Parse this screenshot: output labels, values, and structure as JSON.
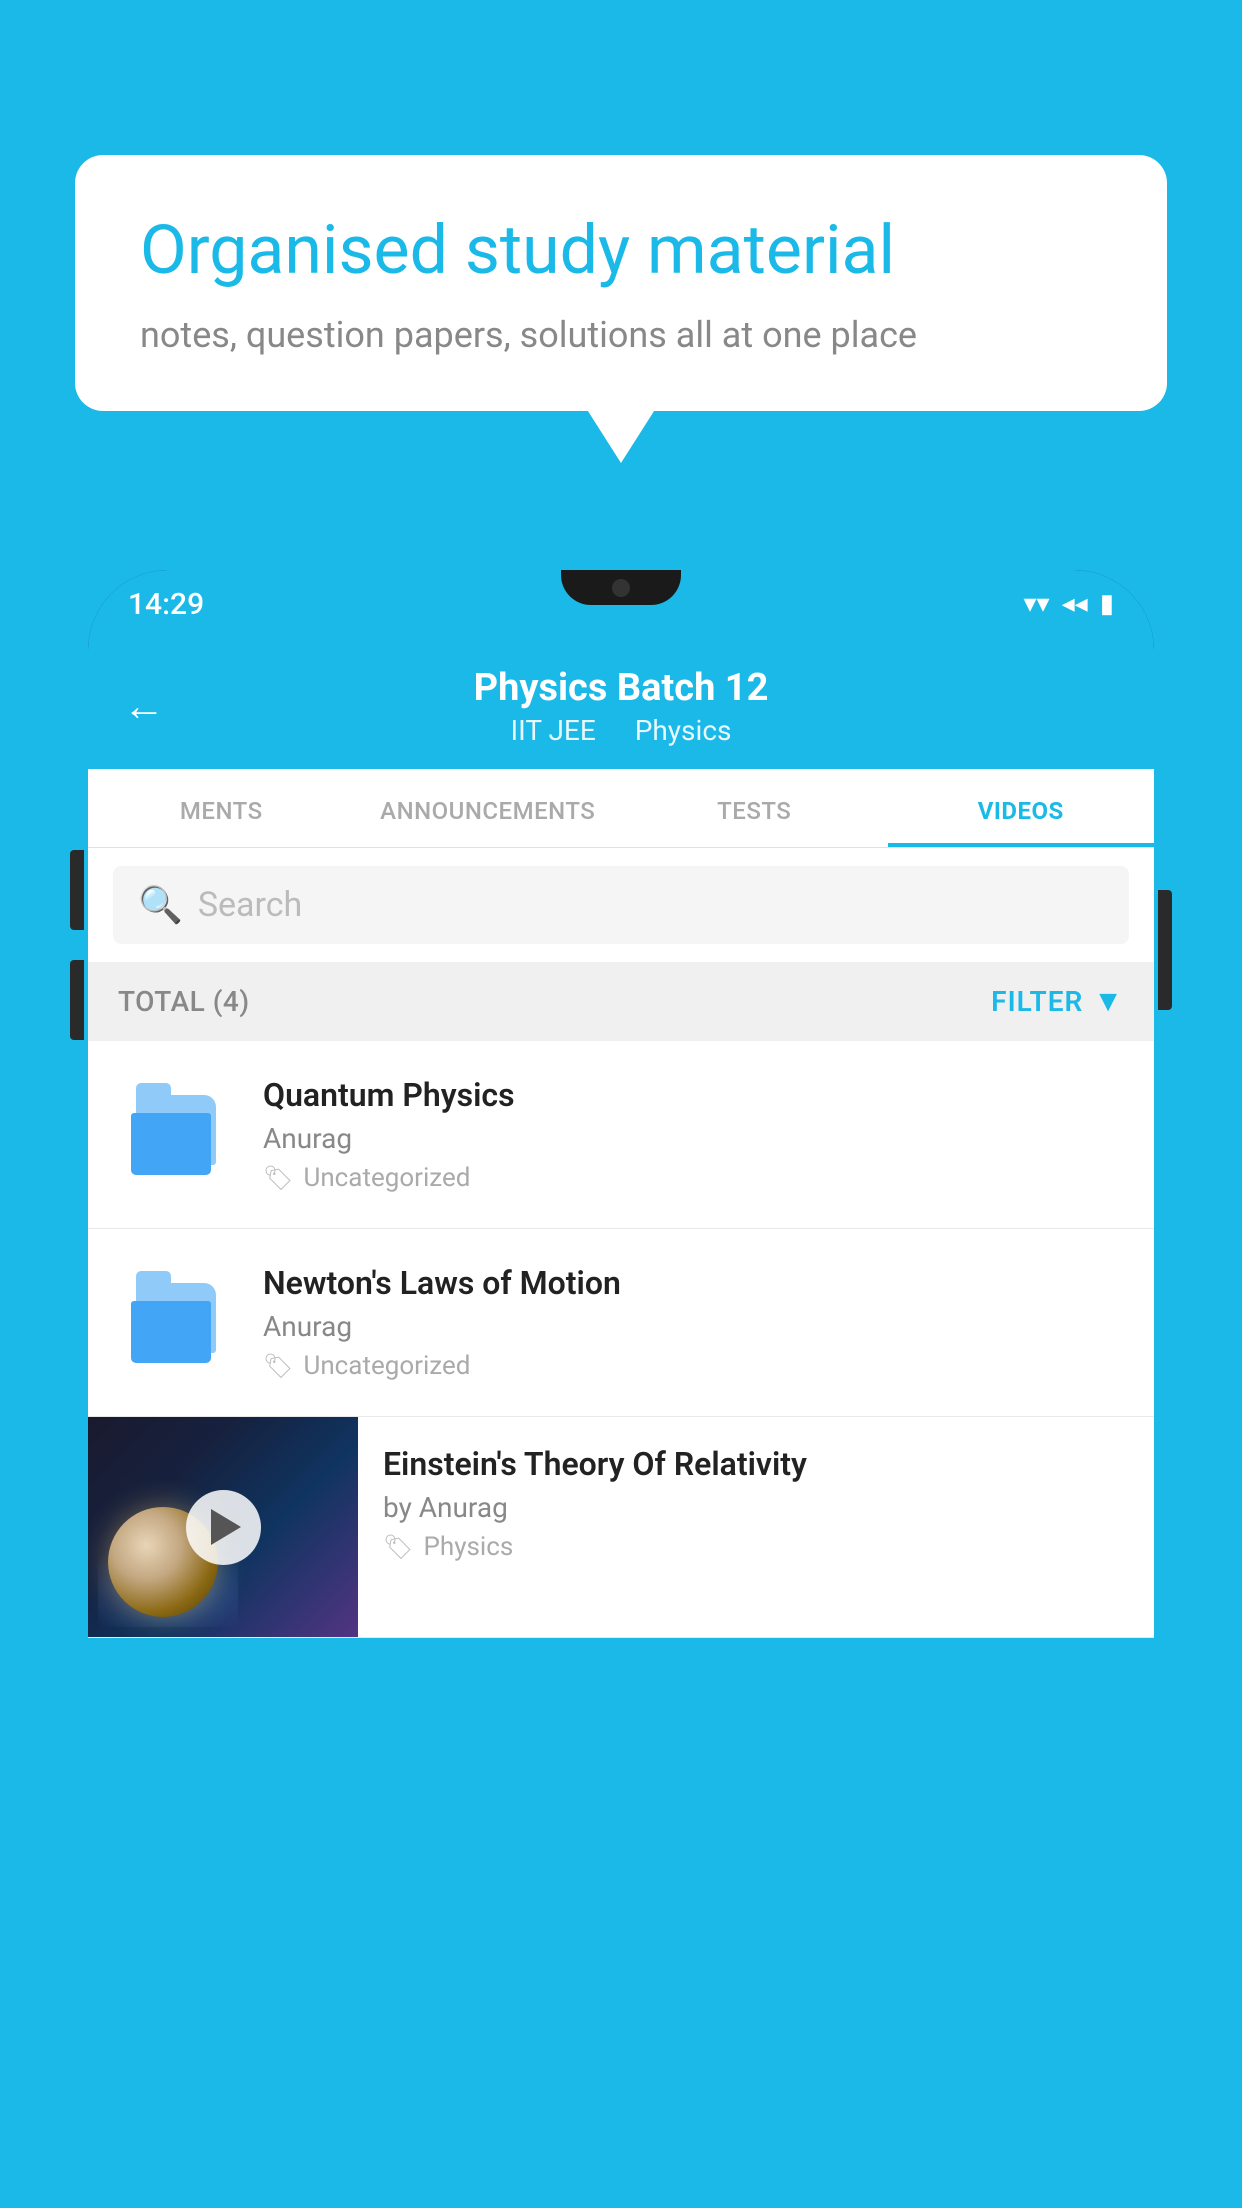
{
  "background_color": "#1ab9e8",
  "bubble": {
    "title": "Organised study material",
    "subtitle": "notes, question papers, solutions all at one place"
  },
  "status_bar": {
    "time": "14:29",
    "wifi_icon": "▼",
    "signal_icon": "◀",
    "battery_icon": "▮"
  },
  "header": {
    "back_label": "←",
    "title": "Physics Batch 12",
    "tag1": "IIT JEE",
    "tag2": "Physics"
  },
  "tabs": [
    {
      "label": "MENTS",
      "active": false
    },
    {
      "label": "ANNOUNCEMENTS",
      "active": false
    },
    {
      "label": "TESTS",
      "active": false
    },
    {
      "label": "VIDEOS",
      "active": true
    }
  ],
  "search": {
    "placeholder": "Search"
  },
  "filter_bar": {
    "total_label": "TOTAL (4)",
    "filter_label": "FILTER"
  },
  "videos": [
    {
      "id": 1,
      "title": "Quantum Physics",
      "author": "Anurag",
      "tag": "Uncategorized",
      "type": "folder",
      "has_thumb": false
    },
    {
      "id": 2,
      "title": "Newton's Laws of Motion",
      "author": "Anurag",
      "tag": "Uncategorized",
      "type": "folder",
      "has_thumb": false
    },
    {
      "id": 3,
      "title": "Einstein's Theory Of Relativity",
      "author": "by Anurag",
      "tag": "Physics",
      "type": "video",
      "has_thumb": true
    }
  ]
}
